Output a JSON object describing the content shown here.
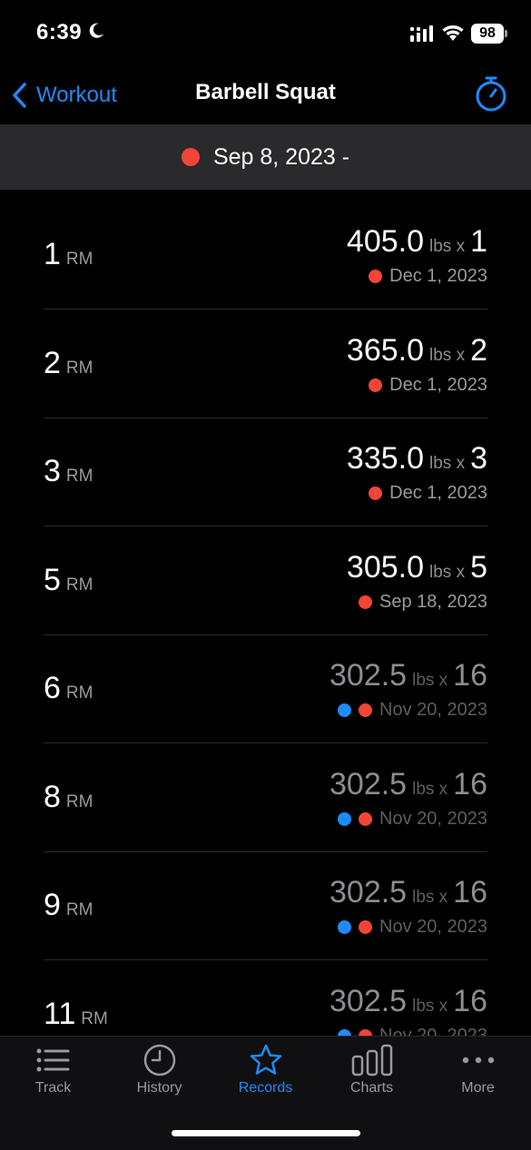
{
  "status": {
    "time": "6:39",
    "battery": "98"
  },
  "nav": {
    "back_label": "Workout",
    "title": "Barbell Squat"
  },
  "date_filter": {
    "label": "Sep 8, 2023 -"
  },
  "records": [
    {
      "reps": "1",
      "rm_label": "RM",
      "weight": "405.0",
      "unit": "lbs x",
      "count": "1",
      "date": "Dec 1, 2023",
      "dots": [
        "red"
      ],
      "dim": false
    },
    {
      "reps": "2",
      "rm_label": "RM",
      "weight": "365.0",
      "unit": "lbs x",
      "count": "2",
      "date": "Dec 1, 2023",
      "dots": [
        "red"
      ],
      "dim": false
    },
    {
      "reps": "3",
      "rm_label": "RM",
      "weight": "335.0",
      "unit": "lbs x",
      "count": "3",
      "date": "Dec 1, 2023",
      "dots": [
        "red"
      ],
      "dim": false
    },
    {
      "reps": "5",
      "rm_label": "RM",
      "weight": "305.0",
      "unit": "lbs x",
      "count": "5",
      "date": "Sep 18, 2023",
      "dots": [
        "red"
      ],
      "dim": false
    },
    {
      "reps": "6",
      "rm_label": "RM",
      "weight": "302.5",
      "unit": "lbs x",
      "count": "16",
      "date": "Nov 20, 2023",
      "dots": [
        "blue",
        "red"
      ],
      "dim": true
    },
    {
      "reps": "8",
      "rm_label": "RM",
      "weight": "302.5",
      "unit": "lbs x",
      "count": "16",
      "date": "Nov 20, 2023",
      "dots": [
        "blue",
        "red"
      ],
      "dim": true
    },
    {
      "reps": "9",
      "rm_label": "RM",
      "weight": "302.5",
      "unit": "lbs x",
      "count": "16",
      "date": "Nov 20, 2023",
      "dots": [
        "blue",
        "red"
      ],
      "dim": true
    },
    {
      "reps": "11",
      "rm_label": "RM",
      "weight": "302.5",
      "unit": "lbs x",
      "count": "16",
      "date": "Nov 20, 2023",
      "dots": [
        "blue",
        "red"
      ],
      "dim": true
    }
  ],
  "tabs": [
    {
      "label": "Track",
      "icon": "list-icon",
      "active": false
    },
    {
      "label": "History",
      "icon": "clock-icon",
      "active": false
    },
    {
      "label": "Records",
      "icon": "star-icon",
      "active": true
    },
    {
      "label": "Charts",
      "icon": "bar-chart-icon",
      "active": false
    },
    {
      "label": "More",
      "icon": "ellipsis-icon",
      "active": false
    }
  ],
  "colors": {
    "accent": "#1d8cf8",
    "record_red": "#f24537",
    "background": "#000000"
  }
}
